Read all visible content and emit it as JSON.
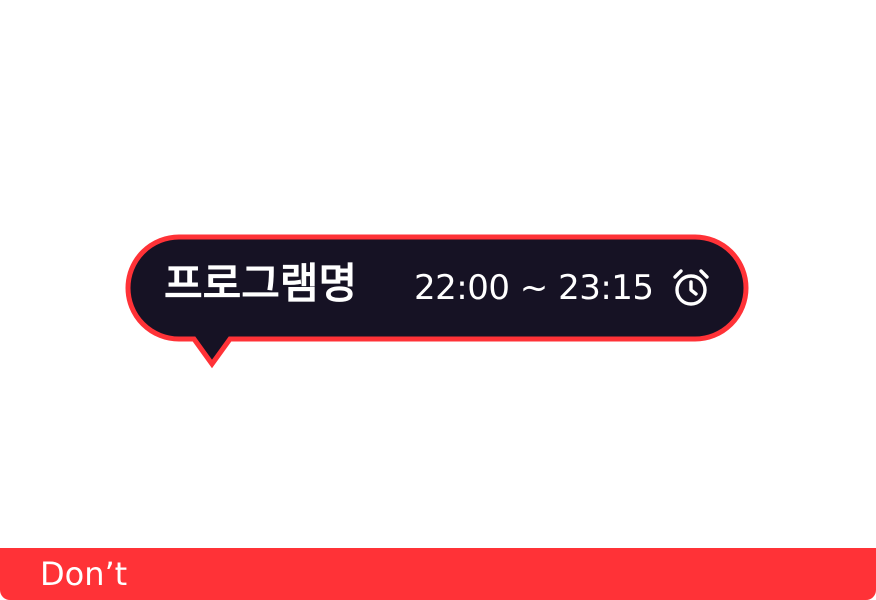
{
  "bubble": {
    "program_name": "프로그램명",
    "time_range": "22:00 ~ 23:15",
    "icon": "alarm-clock-icon"
  },
  "footer": {
    "label": "Don’t"
  },
  "colors": {
    "bubble_fill": "#161224",
    "bubble_border": "#ff3237",
    "text": "#ffffff",
    "footer_bg": "#ff3237",
    "page_bg": "#ffffff"
  }
}
